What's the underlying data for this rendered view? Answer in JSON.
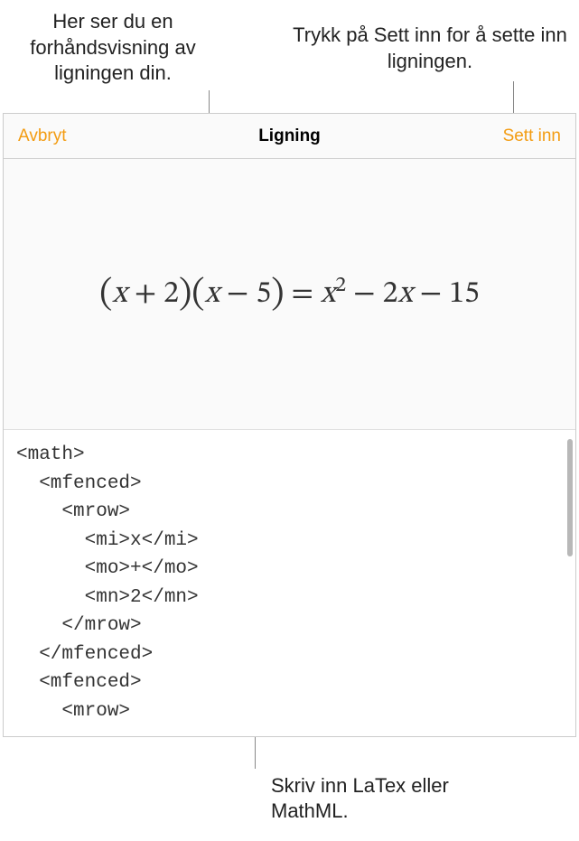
{
  "callouts": {
    "top_left": "Her ser du en forhåndsvisning av ligningen din.",
    "top_right": "Trykk på Sett inn for å sette inn ligningen.",
    "bottom": "Skriv inn LaTex eller MathML."
  },
  "toolbar": {
    "cancel_label": "Avbryt",
    "title": "Ligning",
    "insert_label": "Sett inn"
  },
  "equation": {
    "lparen1": "(",
    "x1": "x",
    "plus": " + ",
    "two": "2",
    "rparen1": ")",
    "lparen2": "(",
    "x2": "x",
    "minus1": " − ",
    "five": "5",
    "rparen2": ")",
    "eq": " = ",
    "x3": "x",
    "sq": "2",
    "minus2": " − ",
    "twocoef": "2",
    "x4": "x",
    "minus3": " − ",
    "fifteen": "15"
  },
  "code_content": "<math>\n  <mfenced>\n    <mrow>\n      <mi>x</mi>\n      <mo>+</mo>\n      <mn>2</mn>\n    </mrow>\n  </mfenced>\n  <mfenced>\n    <mrow>"
}
